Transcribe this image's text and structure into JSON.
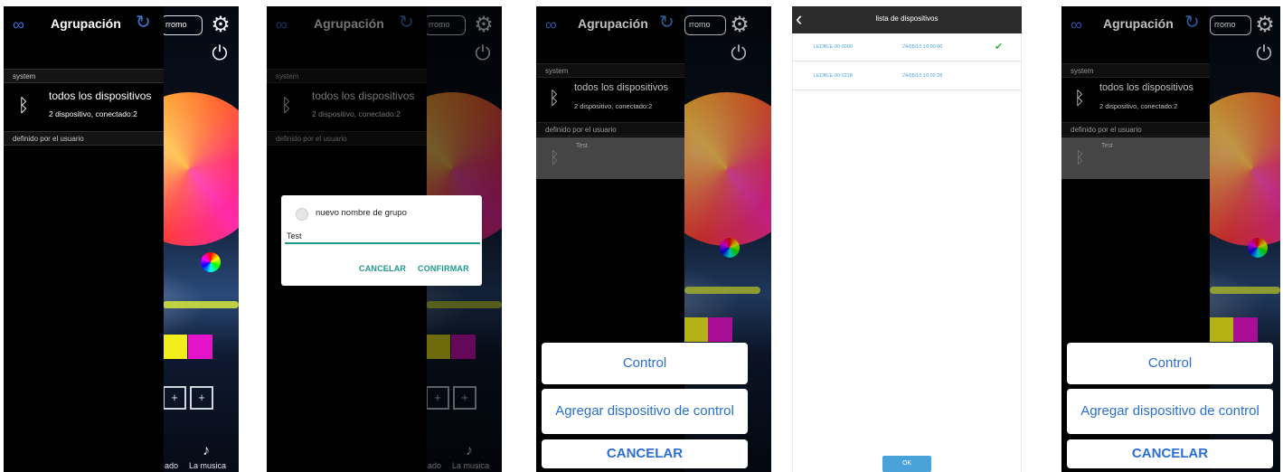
{
  "header": {
    "title": "Agrupación",
    "mode_fragment": "rromo"
  },
  "sections": {
    "system": "system",
    "user_defined": "definido por el usuario"
  },
  "all_devices": {
    "title": "todos los dispositivos",
    "subtitle": "2 dispositivo, conectado:2"
  },
  "custom_group": {
    "name": "Test"
  },
  "background": {
    "music_label": "La musica",
    "mode_label": "ado"
  },
  "rename_dialog": {
    "title": "nuevo nombre de grupo",
    "input_value": "Test",
    "cancel_label": "CANCELAR",
    "confirm_label": "CONFIRMAR"
  },
  "action_sheet": {
    "control_label": "Control",
    "add_device_label": "Agregar dispositivo de control",
    "cancel_label": "CANCELAR"
  },
  "device_list": {
    "title": "lista de dispositivos",
    "rows": [
      {
        "name": "LEDBLE-00:0000",
        "time": "24/05/15 10:00:00",
        "checked": true
      },
      {
        "name": "LEDBLE-00:0228",
        "time": "24/05/15 10:02:28",
        "checked": false
      }
    ],
    "ok_label": "OK"
  },
  "colors": {
    "accent_teal": "#1e9a8c",
    "ios_blue": "#2a6fd0",
    "list_blue": "#4aa2da",
    "magenta": "#e213c8",
    "yellow": "#f1ee1c"
  },
  "icons": [
    "link-logo-icon",
    "refresh-icon",
    "gear-icon",
    "power-icon",
    "bluetooth-icon",
    "color-wheel-icon",
    "music-note-icon",
    "back-arrow-icon",
    "checkmark-icon"
  ]
}
